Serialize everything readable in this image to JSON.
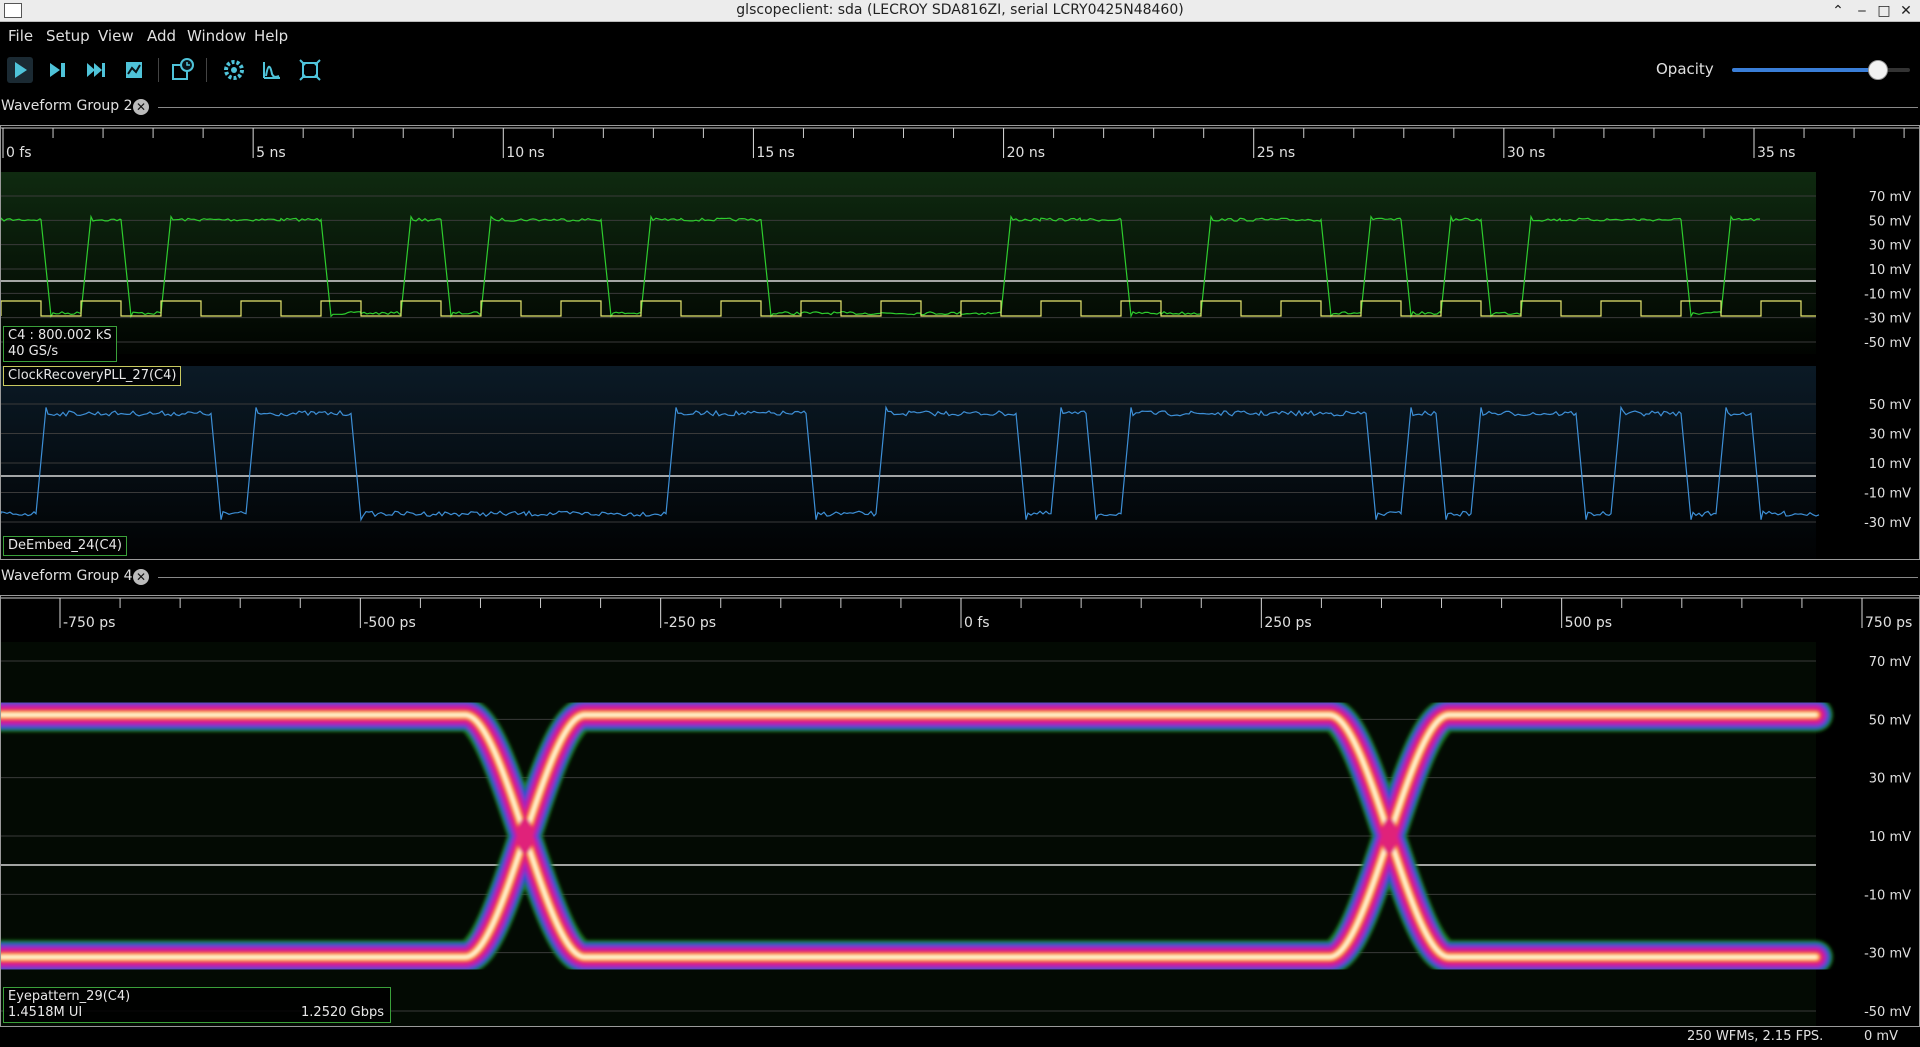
{
  "window": {
    "title": "glscopeclient: sda (LECROY SDA816ZI, serial LCRY0425N48460)"
  },
  "menu": [
    "File",
    "Setup",
    "View",
    "Add",
    "Window",
    "Help"
  ],
  "toolbar": {
    "buttons": [
      "start-trigger",
      "single-trigger",
      "force-trigger",
      "stop-trigger",
      "history",
      "settings",
      "fft",
      "fullscreen"
    ],
    "opacity_label": "Opacity",
    "opacity_value": 0.82
  },
  "groups": [
    {
      "title": "Waveform Group 2",
      "timeline": [
        "0 fs",
        "5 ns",
        "10 ns",
        "15 ns",
        "20 ns",
        "25 ns",
        "30 ns",
        "35 ns"
      ],
      "waveforms": [
        {
          "name": "C4",
          "info_line1": "C4 : 800.002 kS",
          "info_line2": "40 GS/s",
          "color": "#2ecc2e",
          "yaxis": [
            "70 mV",
            "50 mV",
            "30 mV",
            "10 mV",
            "-10 mV",
            "-30 mV",
            "-50 mV"
          ]
        },
        {
          "name": "ClockRecoveryPLL_27(C4)",
          "color": "#e8e870"
        },
        {
          "name": "DeEmbed_24(C4)",
          "color": "#3d8fd6",
          "yaxis": [
            "50 mV",
            "30 mV",
            "10 mV",
            "-10 mV",
            "-30 mV"
          ]
        }
      ]
    },
    {
      "title": "Waveform Group 4",
      "timeline": [
        "-750 ps",
        "-500 ps",
        "-250 ps",
        "0 fs",
        "250 ps",
        "500 ps",
        "750 ps"
      ],
      "waveforms": [
        {
          "name": "Eyepattern_29(C4)",
          "ui_count": "1.4518M UI",
          "rate": "1.2520 Gbps",
          "yaxis": [
            "70 mV",
            "50 mV",
            "30 mV",
            "10 mV",
            "-10 mV",
            "-30 mV",
            "-50 mV"
          ]
        }
      ]
    }
  ],
  "status": {
    "fps": "250 WFMs, 2.15 FPS.",
    "cursor": "0 mV"
  },
  "chart_data": [
    {
      "type": "line",
      "title": "C4",
      "xlabel": "",
      "ylabel": "",
      "xlim": [
        0,
        36.3
      ],
      "x_unit": "ns",
      "ylim": [
        -55,
        75
      ],
      "y_unit": "mV",
      "grid": true,
      "series": [
        {
          "name": "C4",
          "color": "#2ecc2e",
          "bits": [
            1,
            0,
            1,
            0,
            1,
            1,
            1,
            1,
            0,
            0,
            1,
            0,
            1,
            1,
            1,
            0,
            1,
            1,
            1,
            0,
            0,
            0,
            0,
            0,
            0,
            1,
            1,
            1,
            0,
            0,
            1,
            1,
            1,
            0,
            1,
            0,
            1,
            0,
            1,
            1,
            1,
            1,
            0,
            1
          ],
          "bit_period_ns": 0.8,
          "high_mV": 51,
          "low_mV": -30
        }
      ]
    },
    {
      "type": "line",
      "title": "ClockRecoveryPLL_27(C4)",
      "xlim": [
        0,
        36.3
      ],
      "x_unit": "ns",
      "series": [
        {
          "name": "ClockRecoveryPLL_27(C4)",
          "color": "#e8e870",
          "period_ns": 1.6
        }
      ]
    },
    {
      "type": "line",
      "title": "DeEmbed_24(C4)",
      "xlabel": "",
      "ylabel": "",
      "xlim": [
        0,
        36.3
      ],
      "x_unit": "ns",
      "ylim": [
        -40,
        60
      ],
      "y_unit": "mV",
      "grid": true,
      "series": [
        {
          "name": "DeEmbed_24(C4)",
          "color": "#3d8fd6",
          "bits": [
            0,
            1,
            1,
            1,
            1,
            1,
            0,
            1,
            1,
            1,
            0,
            0,
            0,
            0,
            0,
            0,
            0,
            0,
            0,
            1,
            1,
            1,
            1,
            0,
            0,
            1,
            1,
            1,
            1,
            0,
            1,
            0,
            1,
            1,
            1,
            1,
            1,
            1,
            1,
            0,
            1,
            0,
            1,
            1,
            1,
            0,
            1,
            1,
            0,
            1,
            0,
            0
          ],
          "bit_period_ns": 0.7,
          "high_mV": 52,
          "low_mV": -33
        }
      ]
    },
    {
      "type": "heatmap",
      "title": "Eyepattern_29(C4)",
      "xlabel": "",
      "ylabel": "",
      "xlim": [
        -885,
        795
      ],
      "x_unit": "ps",
      "ylim": [
        -55,
        75
      ],
      "y_unit": "mV",
      "grid": true,
      "crossings_ps": [
        -400,
        400
      ],
      "high_mV": 55,
      "low_mV": -35
    }
  ]
}
